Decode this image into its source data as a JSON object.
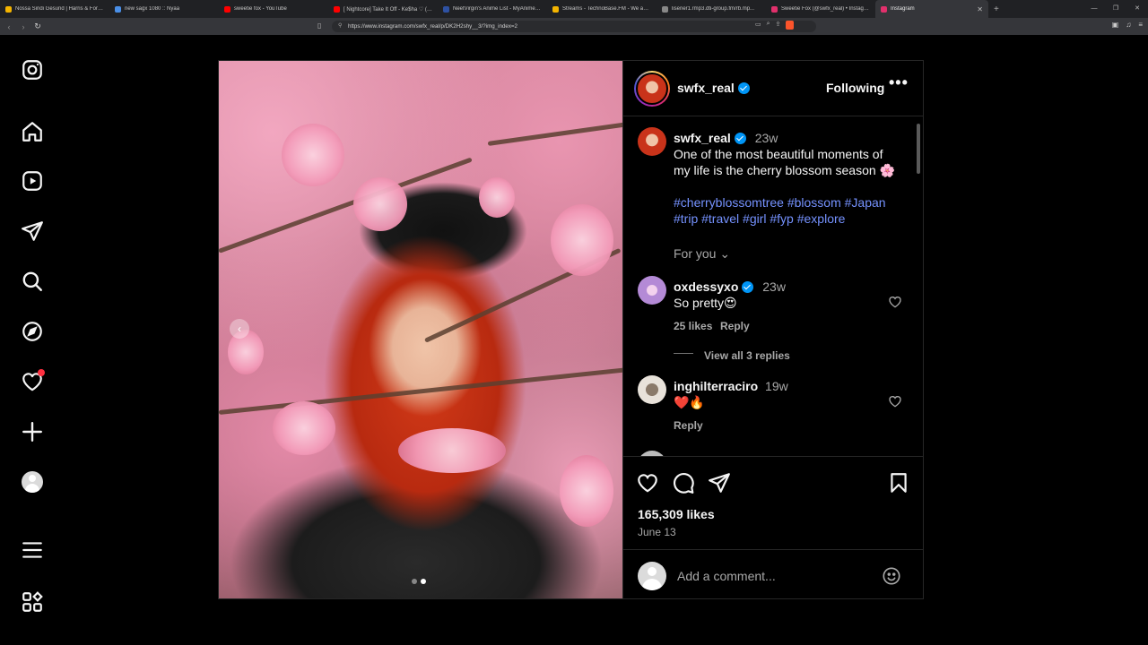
{
  "browser": {
    "tabs": [
      {
        "label": "Nossa Sindi Gesund | Harris & Ford R...",
        "color": "#f4b400"
      },
      {
        "label": "new sagx 1080 :: Nyaa",
        "color": "#4a8fe7"
      },
      {
        "label": "sweetie fox - YouTube",
        "color": "#ff0000"
      },
      {
        "label": "[ Nightcore] Take It Off - Ke$ha ♡ (L...",
        "color": "#ff0000"
      },
      {
        "label": "NeetVirgin's Anime List - MyAnimeL...",
        "color": "#2e51a2"
      },
      {
        "label": "Streams - TechnoBase.FM - We aRe...",
        "color": "#f4b400"
      },
      {
        "label": "lisener1.rmp3.dti-group.fm/rb.mp...",
        "color": "#888888"
      },
      {
        "label": "Sweetie Fox (@swfx_real) • Instagram",
        "color": "#e1306c"
      },
      {
        "label": "Instagram",
        "color": "#e1306c"
      }
    ],
    "url": "https://www.instagram.com/swfx_real/p/DK2H2shy__3/?img_index=2"
  },
  "sidebar": {
    "items": [
      {
        "name": "instagram-logo-icon",
        "label": "Instagram"
      },
      {
        "name": "home-icon",
        "label": "Home"
      },
      {
        "name": "reels-icon",
        "label": "Reels"
      },
      {
        "name": "messages-icon",
        "label": "Messages"
      },
      {
        "name": "search-icon",
        "label": "Search"
      },
      {
        "name": "explore-icon",
        "label": "Explore"
      },
      {
        "name": "notifications-icon",
        "label": "Notifications"
      },
      {
        "name": "create-icon",
        "label": "Create"
      },
      {
        "name": "profile-icon",
        "label": "Profile"
      },
      {
        "name": "more-menu-icon",
        "label": "More"
      },
      {
        "name": "also-from-meta-icon",
        "label": "Also from Meta"
      }
    ]
  },
  "post": {
    "username": "swfx_real",
    "follow_status": "Following",
    "more": "•••",
    "caption": {
      "username": "swfx_real",
      "time": "23w",
      "text": "One of the most beautiful moments of my life is the cherry blossom season 🌸",
      "hashtags": "#cherryblossomtree #blossom #Japan #trip #travel #girl #fyp #explore"
    },
    "for_you": "For you",
    "comments": [
      {
        "username": "oxdessyxo",
        "time": "23w",
        "text": "So pretty😍",
        "likes": "25 likes",
        "reply": "Reply",
        "view_replies": "View all 3 replies"
      },
      {
        "username": "inghilterraciro",
        "time": "19w",
        "text": "❤️🔥",
        "reply": "Reply"
      }
    ],
    "likes": "165,309 likes",
    "date": "June 13",
    "comment_placeholder": "Add a comment...",
    "carousel": {
      "current": 2,
      "total": 2
    }
  }
}
